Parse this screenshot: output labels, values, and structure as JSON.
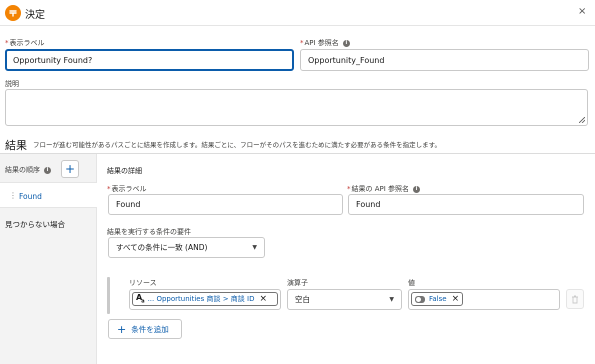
{
  "header": {
    "title": "決定",
    "close_glyph": "×",
    "icon": "decision-icon",
    "icon_color": "#f38303"
  },
  "properties": {
    "label_field": {
      "label": "表示ラベル",
      "value": "Opportunity Found?"
    },
    "api_field": {
      "label": "API 参照名",
      "value": "Opportunity_Found"
    },
    "description_field": {
      "label": "説明",
      "value": ""
    }
  },
  "outcomes_section": {
    "title": "結果",
    "description": "フローが進む可能性があるパスごとに結果を作成します。結果ごとに、フローがそのパスを進むために満たす必要がある条件を指定します。"
  },
  "sidebar": {
    "order_label": "結果の順序",
    "items": [
      {
        "label": "Found"
      }
    ],
    "default_outcome": "見つからない場合"
  },
  "outcome_detail": {
    "heading": "結果の詳細",
    "label_field": {
      "label": "表示ラベル",
      "value": "Found"
    },
    "api_field": {
      "label": "結果の API 参照名",
      "value": "Found"
    },
    "requirement": {
      "label": "結果を実行する条件の要件",
      "value": "すべての条件に一致 (AND)"
    },
    "conditions": {
      "resource_label": "リソース",
      "operator_label": "演算子",
      "value_label": "値",
      "rows": [
        {
          "resource": "... Opportunities 商談 > 商談 ID",
          "operator": "空白",
          "value": "False"
        }
      ]
    },
    "add_condition": "条件を追加"
  },
  "colors": {
    "accent": "#0b5cab",
    "required": "#c23934",
    "sidebar_bg": "#f3f3f3"
  }
}
